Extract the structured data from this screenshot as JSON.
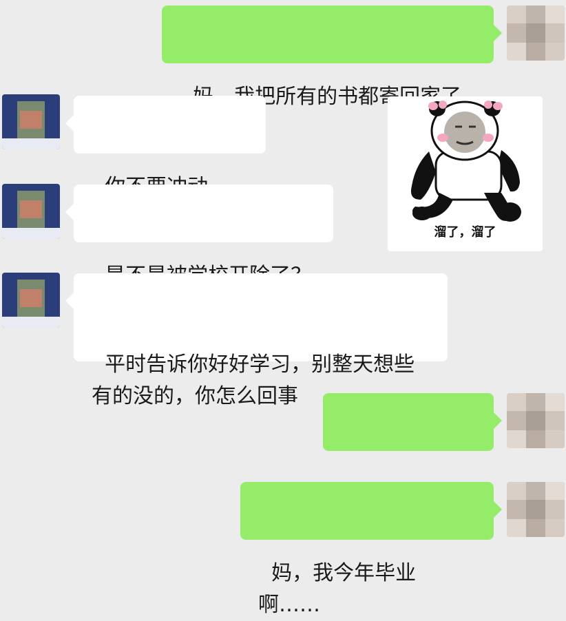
{
  "messages": [
    {
      "id": "m1",
      "side": "out",
      "text": "妈，我把所有的书都寄回家了"
    },
    {
      "id": "m2",
      "side": "in",
      "text": "你不要冲动啊！"
    },
    {
      "id": "m3",
      "side": "in",
      "text": "是不是被学校开除了？"
    },
    {
      "id": "m4",
      "side": "in",
      "text": "平时告诉你好好学习，别整天想些\n有的没的，你怎么回事"
    },
    {
      "id": "m5",
      "side": "out",
      "text": "？？？？？？"
    },
    {
      "id": "m6",
      "side": "out",
      "text": "妈，我今年毕业啊……"
    }
  ],
  "sticker": {
    "caption": "溜了，溜了",
    "icon": "panda-meme-sticker"
  },
  "colors": {
    "background": "#ececec",
    "incoming_bubble": "#ffffff",
    "outgoing_bubble": "#95ec69",
    "mom_avatar": "#2b3e7a",
    "my_avatar": "#cfc7c0"
  }
}
